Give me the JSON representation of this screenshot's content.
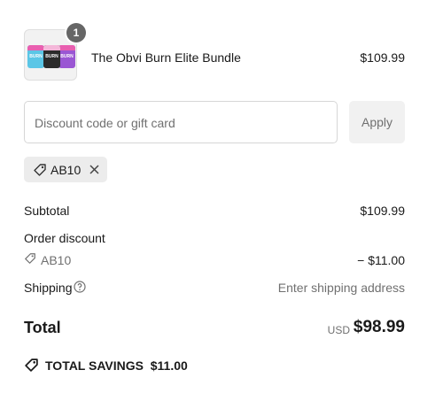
{
  "product": {
    "name": "The Obvi Burn Elite Bundle",
    "price": "$109.99",
    "quantity_badge": "1",
    "thumbnail_label": "BURN"
  },
  "discount": {
    "placeholder": "Discount code or gift card",
    "apply_label": "Apply",
    "applied_code": "AB10"
  },
  "summary": {
    "subtotal_label": "Subtotal",
    "subtotal_value": "$109.99",
    "order_discount_label": "Order discount",
    "discount_code": "AB10",
    "discount_value": "− $11.00",
    "shipping_label": "Shipping",
    "shipping_value": "Enter shipping address",
    "total_label": "Total",
    "currency": "USD",
    "total_value": "$98.99",
    "savings_text": "TOTAL SAVINGS  $11.00"
  },
  "colors": {
    "apply_bg": "#f1f1f1",
    "tag_bg": "#ececec",
    "badge_bg": "#666666",
    "tub_pink": "#e95fb0",
    "tub_blue": "#5bc6e6",
    "tub_black": "#2b2b2b",
    "tub_purple": "#9a56d3"
  }
}
